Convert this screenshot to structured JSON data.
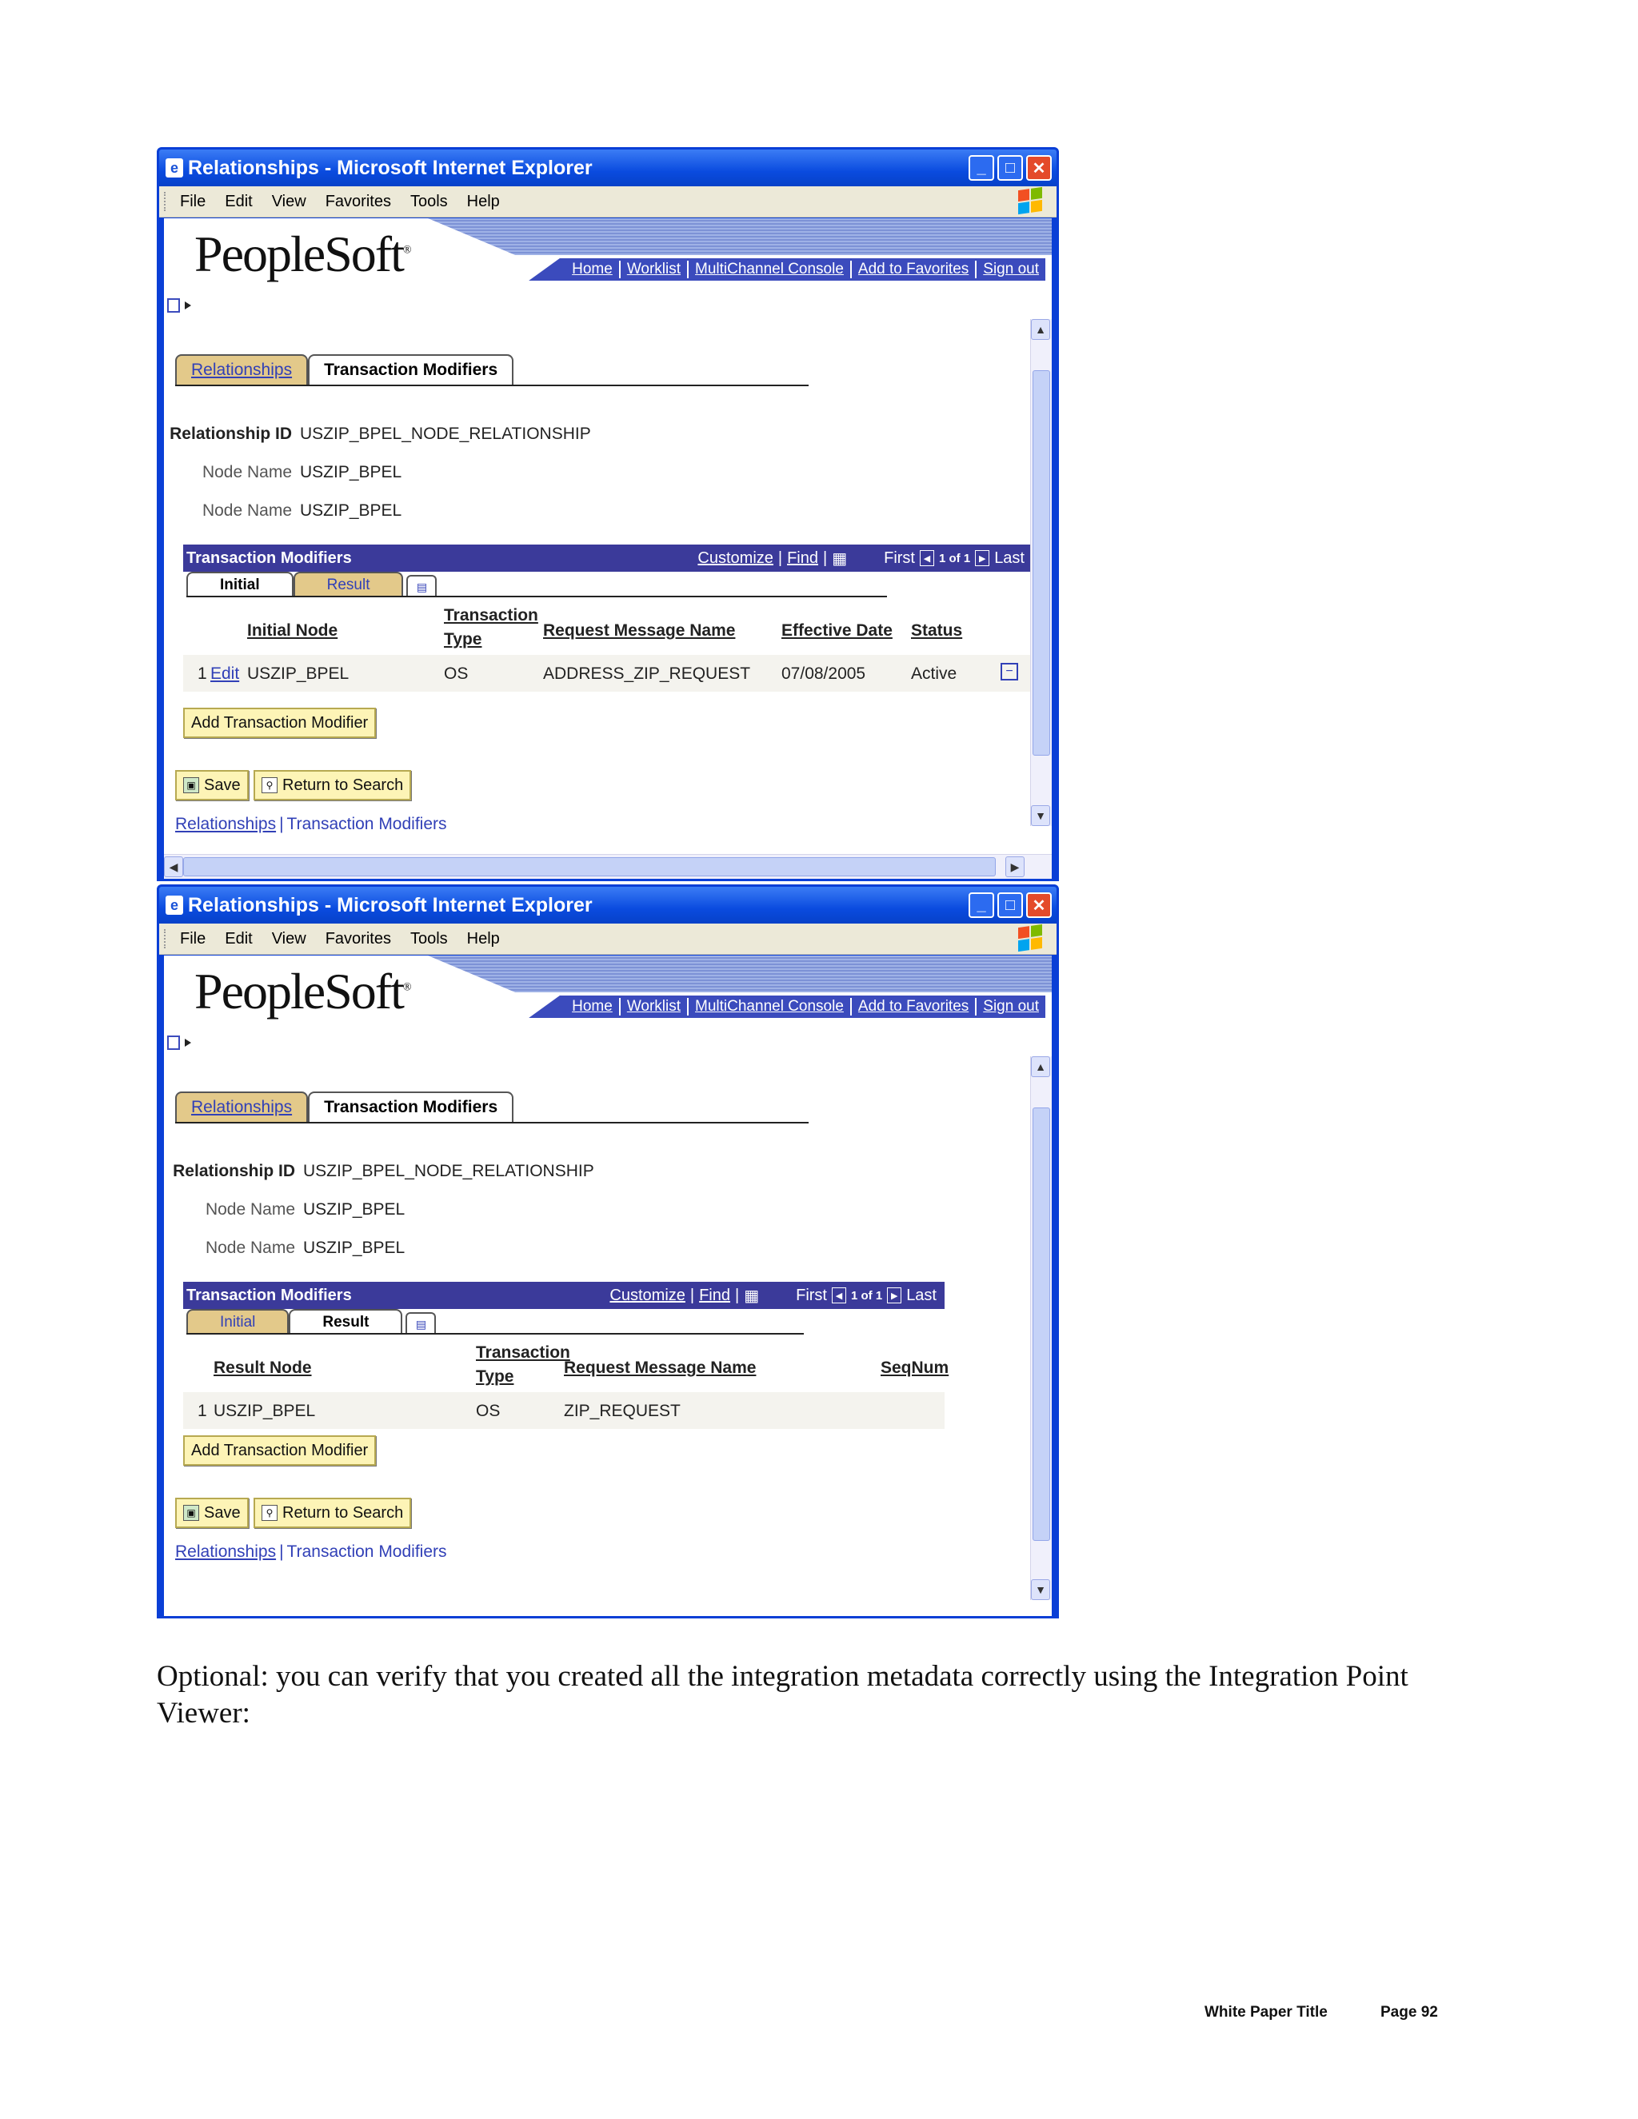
{
  "window": {
    "title": "Relationships - Microsoft Internet Explorer",
    "menu": [
      "File",
      "Edit",
      "View",
      "Favorites",
      "Tools",
      "Help"
    ]
  },
  "peoplesoft": {
    "logo": "PeopleSoft",
    "nav": [
      "Home",
      "Worklist",
      "MultiChannel Console",
      "Add to Favorites",
      "Sign out"
    ]
  },
  "page_tabs": [
    "Relationships",
    "Transaction Modifiers"
  ],
  "fields": {
    "relationship_id_label": "Relationship ID",
    "relationship_id_value": "USZIP_BPEL_NODE_RELATIONSHIP",
    "node_name_label": "Node Name",
    "node_name_value_1": "USZIP_BPEL",
    "node_name_value_2": "USZIP_BPEL"
  },
  "grid": {
    "title": "Transaction Modifiers",
    "customize": "Customize",
    "find": "Find",
    "first": "First",
    "count": "1 of 1",
    "last": "Last",
    "subtabs": [
      "Initial",
      "Result"
    ]
  },
  "screenshot1": {
    "columns": [
      "Initial Node",
      "Transaction Type",
      "Request Message Name",
      "Effective Date",
      "Status"
    ],
    "row": {
      "num": "1",
      "edit": "Edit",
      "node": "USZIP_BPEL",
      "type": "OS",
      "message": "ADDRESS_ZIP_REQUEST",
      "date": "07/08/2005",
      "status": "Active"
    }
  },
  "screenshot2": {
    "columns": [
      "Result Node",
      "Transaction Type",
      "Request Message Name",
      "SeqNum"
    ],
    "row": {
      "num": "1",
      "node": "USZIP_BPEL",
      "type": "OS",
      "message": "ZIP_REQUEST"
    }
  },
  "buttons": {
    "add_modifier": "Add Transaction Modifier",
    "save": "Save",
    "return_search": "Return to Search"
  },
  "bottom_links": [
    "Relationships",
    "Transaction Modifiers"
  ],
  "body_text": "Optional: you can verify that you created all the integration metadata correctly using the Integration Point Viewer:",
  "footer": {
    "title": "White Paper Title",
    "page": "Page 92"
  }
}
